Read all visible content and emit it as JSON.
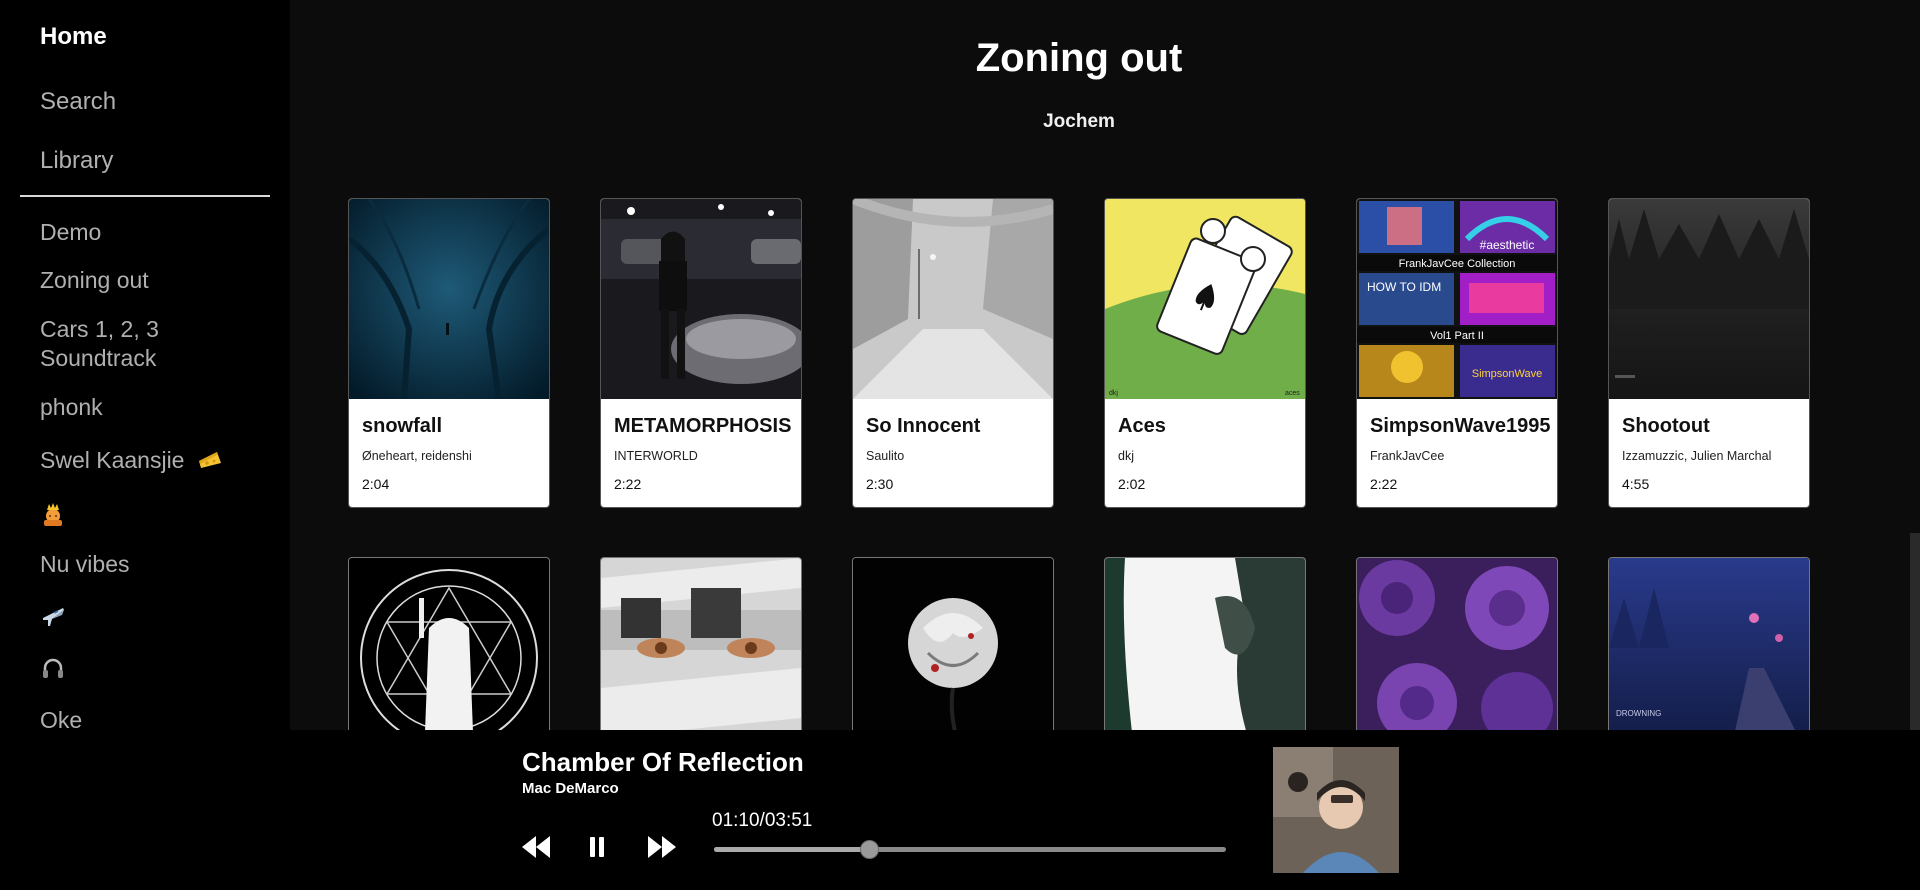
{
  "nav": {
    "home": "Home",
    "search": "Search",
    "library": "Library"
  },
  "playlists": [
    "Demo",
    "Zoning out",
    "Cars 1, 2, 3 Soundtrack",
    "phonk",
    "Swel Kaansjie",
    "Nu vibes",
    "Oke"
  ],
  "page": {
    "title": "Zoning out",
    "owner": "Jochem"
  },
  "tracks": [
    {
      "title": "snowfall",
      "artist": "Øneheart, reidenshi",
      "duration": "2:04"
    },
    {
      "title": "METAMORPHOSIS",
      "artist": "INTERWORLD",
      "duration": "2:22"
    },
    {
      "title": "So Innocent",
      "artist": "Saulito",
      "duration": "2:30"
    },
    {
      "title": "Aces",
      "artist": "dkj",
      "duration": "2:02",
      "cover_text_left": "dkj",
      "cover_text_right": "aces"
    },
    {
      "title": "SimpsonWave1995",
      "artist": "FrankJavCee",
      "duration": "2:22",
      "cover_text": [
        "FrankJavCee Collection",
        "#aesthetic",
        "HOW TO IDM",
        "Vol1 Part II",
        "SimpsonWave"
      ]
    },
    {
      "title": "Shootout",
      "artist": "Izzamuzzic, Julien Marchal",
      "duration": "4:55"
    }
  ],
  "row2_cover_texts": {
    "drowning": "DROWNING"
  },
  "player": {
    "title": "Chamber Of Reflection",
    "artist": "Mac DeMarco",
    "time": "01:10/03:51",
    "progress": 0.303,
    "state": "playing"
  },
  "icons": {
    "queen": "queen-emoji-icon",
    "plane": "airplane-icon",
    "headphones": "headphones-icon",
    "cheese": "cheese-icon"
  },
  "colors": {
    "background": "#0b0b0b",
    "sidebar": "#000000",
    "card": "#ffffff",
    "muted": "#b0b0b0"
  }
}
